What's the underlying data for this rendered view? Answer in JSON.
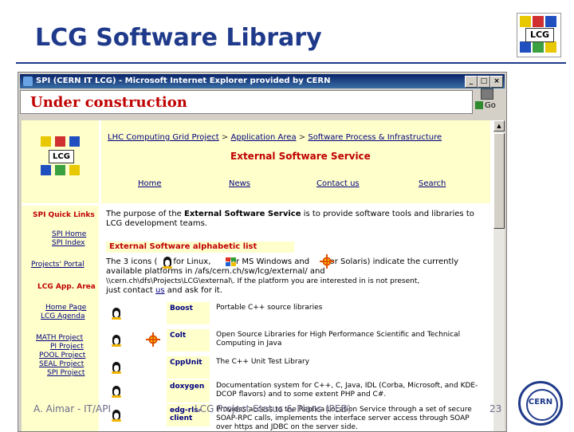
{
  "slide": {
    "title": "LCG Software Library",
    "footer_author": "A. Aimar - IT/API",
    "footer_title": "LCG Project Status & Plans (PEB)",
    "page_number": "23",
    "logo_text": "LCG",
    "cern_logo_text": "CERN"
  },
  "browser": {
    "window_title": "SPI (CERN IT LCG) - Microsoft Internet Explorer provided by CERN",
    "address_overlay": "Under construction",
    "go_label": "Go",
    "buttons": {
      "minimize": "_",
      "maximize": "□",
      "close": "×"
    }
  },
  "page": {
    "logo_text": "LCG",
    "breadcrumb": [
      "LHC Computing Grid Project",
      "Application Area",
      "Software Process & Infrastructure"
    ],
    "breadcrumb_sep": ">",
    "service_title": "External Software Service",
    "nav": [
      "Home",
      "News",
      "Contact us",
      "Search"
    ],
    "sidebar": {
      "quick_links_heading": "SPI Quick Links",
      "quick_links": [
        "SPI Home",
        "SPI Index"
      ],
      "portal": "Projects' Portal",
      "app_area_heading": "LCG App. Area",
      "app_links": [
        "Home Page",
        "LCG Agenda"
      ],
      "projects": [
        "MATH Project",
        "PI Project",
        "POOL Project",
        "SEAL Project",
        "SPI Project"
      ]
    },
    "intro": {
      "pre": "The purpose of the ",
      "bold": "External Software Service",
      "post": " is to provide software tools and libraries to LCG development teams."
    },
    "alpha_heading": "External Software alphabetic list",
    "icons_paragraph": {
      "l1a": "The 3 icons (",
      "l1b": "for Linux,",
      "l1c": "for MS Windows and",
      "l1d": "for Solaris) indicate the currently",
      "l2": "available platforms in /afs/cern.ch/sw/lcg/external/ and",
      "l3a": "\\\\cern.ch\\dfs\\Projects\\LCG\\external\\. If the platform you are interested in is not present,",
      "l4a": "just contact ",
      "l4link": "us",
      "l4b": " and ask for it."
    },
    "packages": [
      {
        "name": "Boost",
        "desc": "Portable C++ source libraries",
        "platforms": [
          "linux"
        ]
      },
      {
        "name": "Colt",
        "desc": "Open Source Libraries for High Performance Scientific and Technical Computing in Java",
        "platforms": [
          "linux",
          "solaris"
        ]
      },
      {
        "name": "CppUnit",
        "desc": "The C++ Unit Test Library",
        "platforms": [
          "linux"
        ]
      },
      {
        "name": "doxygen",
        "desc": "Documentation system for C++, C, Java, IDL (Corba, Microsoft, and KDE-DCOP flavors) and to some extent PHP and C#.",
        "platforms": [
          "linux"
        ]
      },
      {
        "name": "edg-rls-client",
        "desc": "Provides access to the Replica Location Service through a set of secure SOAP-RPC calls, implements the interface server access through SOAP over https and JDBC on the server side.",
        "platforms": [
          "linux"
        ]
      }
    ]
  },
  "colors": {
    "title_blue": "#1f3a8a",
    "red_heading": "#c00000",
    "pale_yellow": "#ffffcc",
    "link_blue": "#000080"
  }
}
